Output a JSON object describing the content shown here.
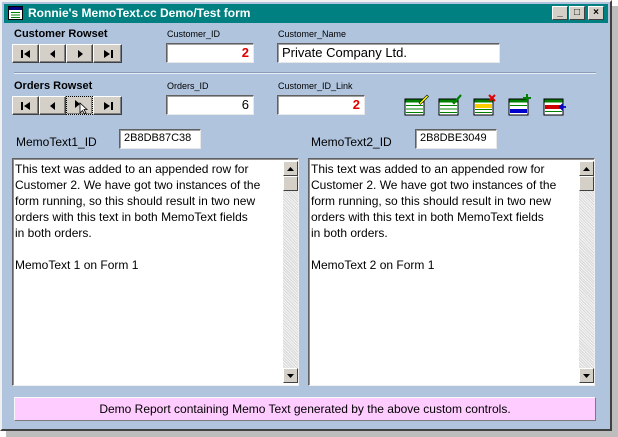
{
  "window": {
    "title": "Ronnie's MemoText.cc Demo/Test form",
    "controls": {
      "minimize": "_",
      "maximize": "□",
      "close": "×"
    }
  },
  "customer": {
    "rowset_label": "Customer Rowset",
    "id_label": "Customer_ID",
    "id_value": "2",
    "name_label": "Customer_Name",
    "name_value": "Private Company Ltd."
  },
  "orders": {
    "rowset_label": "Orders Rowset",
    "id_label": "Orders_ID",
    "id_value": "6",
    "link_label": "Customer_ID_Link",
    "link_value": "2"
  },
  "memo1": {
    "id_label": "MemoText1_ID",
    "id_value": "2B8DB87C38",
    "text": "This text was added to an appended row for\nCustomer 2. We have got two instances of the\nform running, so this should result in two new\norders with this text in both MemoText fields\nin both orders.\n\nMemoText 1 on Form 1"
  },
  "memo2": {
    "id_label": "MemoText2_ID",
    "id_value": "2B8DBE3049",
    "text": "This text was added to an appended row for\nCustomer 2. We have got two instances of the\nform running, so this should result in two new\norders with this text in both MemoText fields\nin both orders.\n\nMemoText 2 on Form 1"
  },
  "report_button": "Demo Report containing Memo Text generated by the above custom controls.",
  "icons": {
    "nav": [
      "first-record-icon",
      "prev-record-icon",
      "next-record-icon",
      "last-record-icon"
    ],
    "tools": [
      "edit-record-icon",
      "save-record-icon",
      "delete-record-icon",
      "add-record-icon",
      "append-record-icon"
    ]
  },
  "colors": {
    "form_bg": "#b0c4de",
    "titlebar": "#008080",
    "report_bg": "#ffccff",
    "value_red": "#e00000"
  }
}
